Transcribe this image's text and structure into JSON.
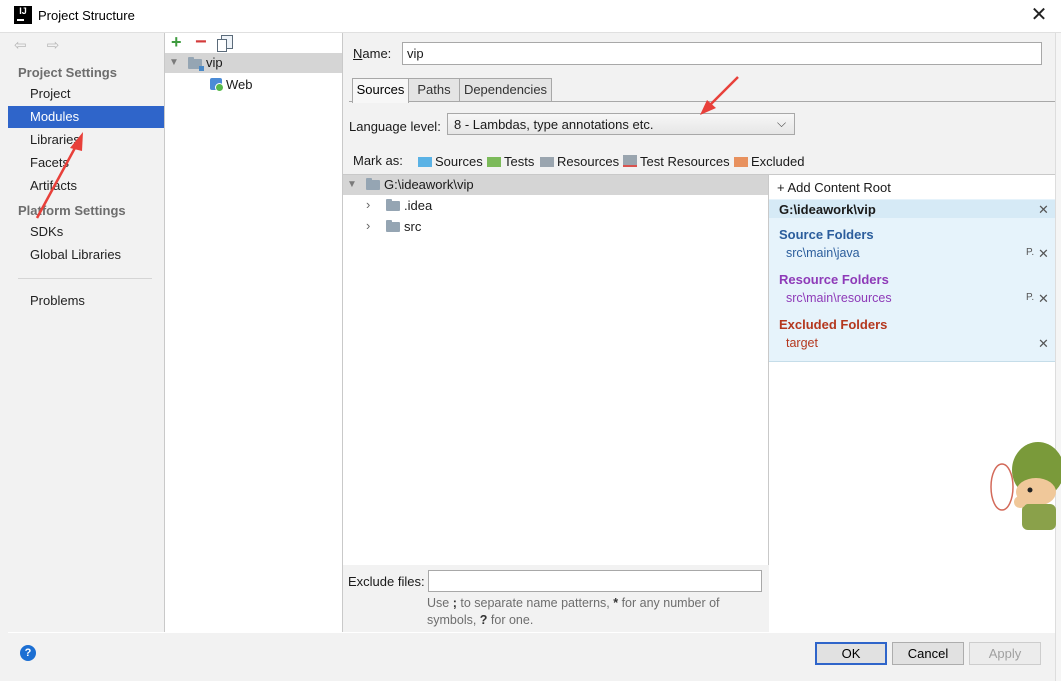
{
  "window": {
    "title": "Project Structure",
    "close": "✕",
    "app_icon": "IJ"
  },
  "nav": {
    "back_forward": "⇦ ⇨",
    "project_settings_header": "Project Settings",
    "platform_settings_header": "Platform Settings",
    "items": [
      {
        "label": "Project"
      },
      {
        "label": "Modules"
      },
      {
        "label": "Libraries"
      },
      {
        "label": "Facets"
      },
      {
        "label": "Artifacts"
      },
      {
        "label": "SDKs"
      },
      {
        "label": "Global Libraries"
      },
      {
        "label": "Problems"
      }
    ]
  },
  "tree": {
    "toolbar": {
      "add": "+",
      "remove": "−"
    },
    "module": "vip",
    "facet": "Web"
  },
  "module": {
    "name_label": "Name:",
    "name_value": "vip",
    "tabs": [
      "Sources",
      "Paths",
      "Dependencies"
    ],
    "language_level_label": "Language level:",
    "language_level_value": "8 - Lambdas, type annotations etc.",
    "mark_as_label": "Mark as:",
    "mark_as": [
      {
        "label": "Sources",
        "color": "#5ab2e5"
      },
      {
        "label": "Tests",
        "color": "#7cba5a"
      },
      {
        "label": "Resources",
        "color": "#9aa5af"
      },
      {
        "label": "Test Resources",
        "color": "#9aa5af"
      },
      {
        "label": "Excluded",
        "color": "#e8915e"
      }
    ],
    "content_tree": {
      "root": "G:\\ideawork\\vip",
      "children": [
        ".idea",
        "src"
      ]
    },
    "add_content_root": "+ Add Content Root",
    "content_root_path": "G:\\ideawork\\vip",
    "source_folders_title": "Source Folders",
    "source_folder": "src\\main\\java",
    "resource_folders_title": "Resource Folders",
    "resource_folder": "src\\main\\resources",
    "excluded_folders_title": "Excluded Folders",
    "excluded_folder": "target",
    "exclude_files_label": "Exclude files:",
    "exclude_files_value": "",
    "hint_before_semicolon": "Use ",
    "hint_semicolon": ";",
    "hint_middle": " to separate name patterns, ",
    "hint_star": "*",
    "hint_after_star": " for any number of symbols, ",
    "hint_q": "?",
    "hint_end": " for one."
  },
  "buttons": {
    "ok": "OK",
    "cancel": "Cancel",
    "apply": "Apply",
    "help": "?"
  },
  "colors": {
    "selection": "#2f65ca",
    "source_folders": "#2b5d9c",
    "resource_folders": "#8e3ab8",
    "excluded_folders": "#b4371e",
    "annotation_arrow": "#e8403a"
  }
}
